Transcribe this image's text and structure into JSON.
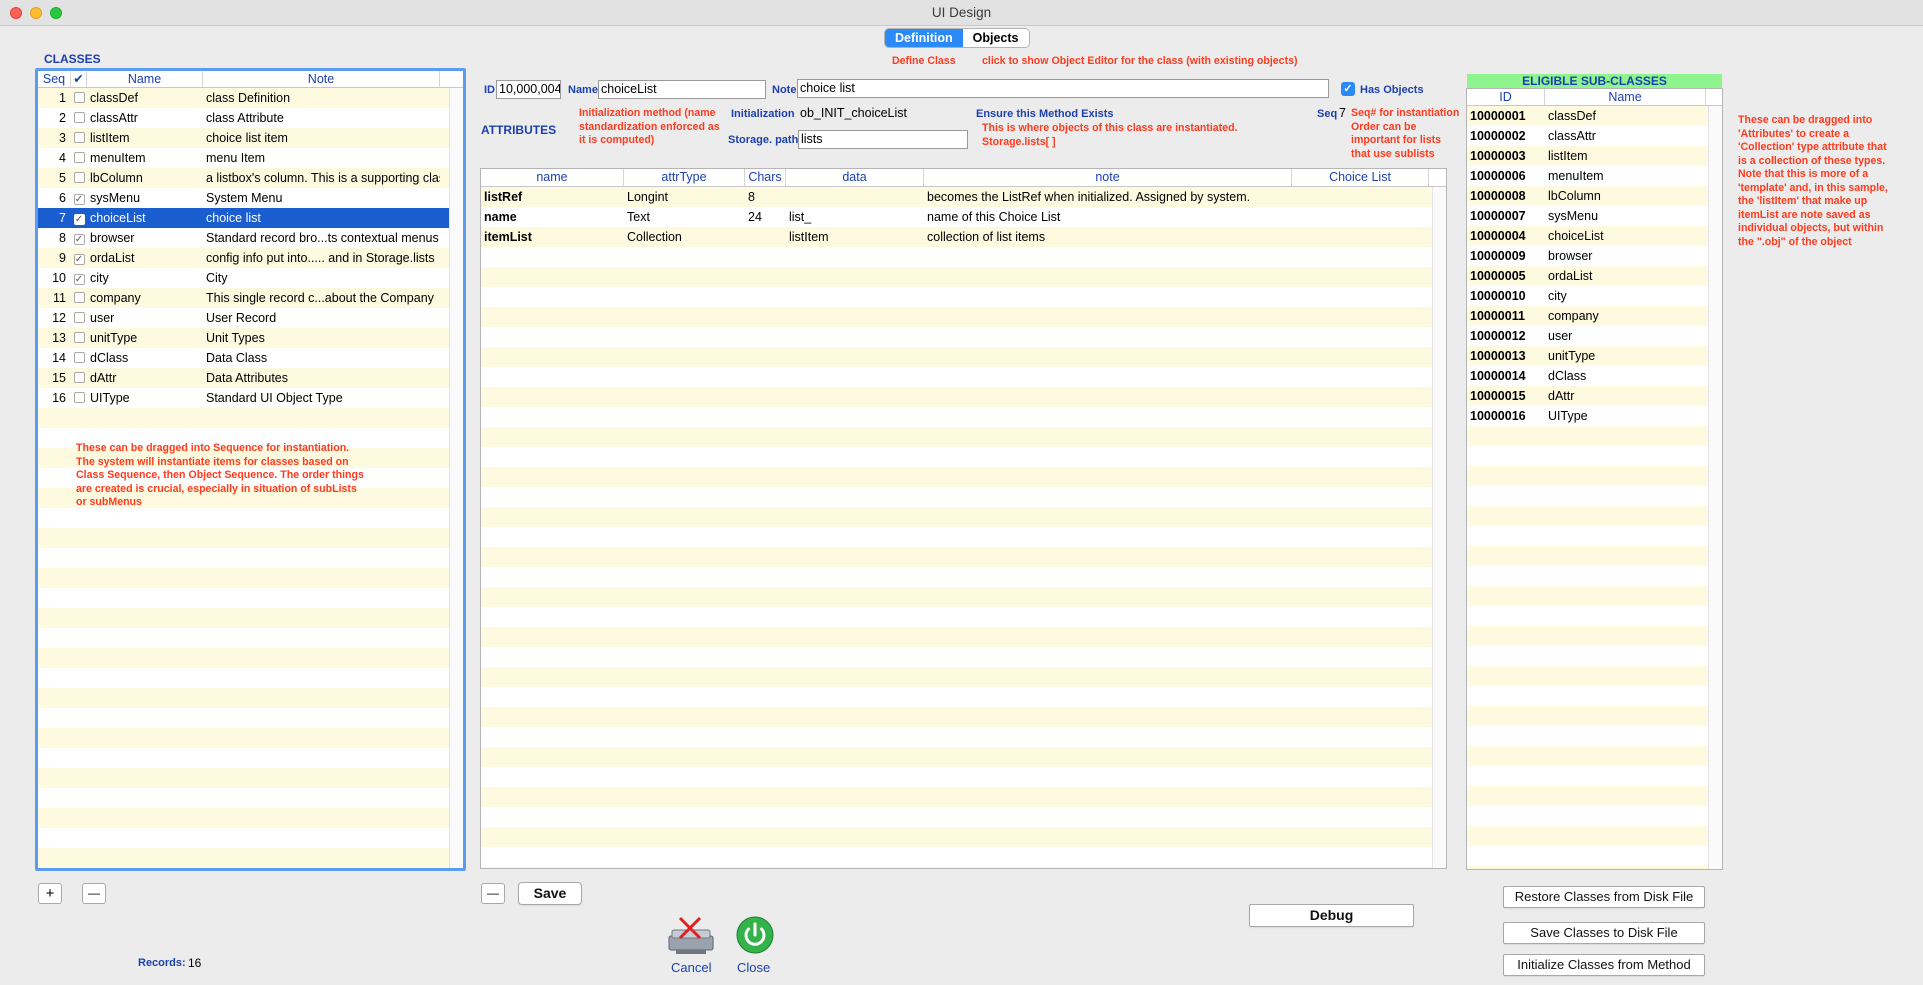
{
  "window": {
    "title": "UI Design"
  },
  "tabs": [
    {
      "label": "Definition"
    },
    {
      "label": "Objects"
    }
  ],
  "hints": {
    "define_class": "Define Class",
    "objects_hint": "click to show Object Editor for the class (with existing objects)",
    "init_hint": "Initialization method (name standardization enforced as it is computed)",
    "ensure_method": "Ensure this Method Exists",
    "instantiated_here": "This is where objects of this class are instantiated.",
    "storage_lists": "Storage.lists[ ]",
    "seq_hint": "Seq# for instantiation Order can be important for lists that use sublists",
    "drag_sequence": "These can be dragged into Sequence for instantiation. The system will instantiate items for classes based on Class Sequence, then Object Sequence. The order things are created is crucial, especially in situation of subLists or subMenus",
    "drag_attributes": "These can be dragged into 'Attributes' to create a 'Collection' type attribute that is a collection of these types. Note that this is more of a 'template' and, in this sample, the 'listItem' that make up itemList are note saved as individual objects, but within the \".obj\" of the object"
  },
  "classes": {
    "title": "CLASSES",
    "headers": {
      "seq": "Seq",
      "check": "✔",
      "name": "Name",
      "note": "Note"
    },
    "rows": [
      {
        "seq": "1",
        "checked": false,
        "name": "classDef",
        "note": "class Definition"
      },
      {
        "seq": "2",
        "checked": false,
        "name": "classAttr",
        "note": "class Attribute"
      },
      {
        "seq": "3",
        "checked": false,
        "name": "listItem",
        "note": "choice list item"
      },
      {
        "seq": "4",
        "checked": false,
        "name": "menuItem",
        "note": "menu Item"
      },
      {
        "seq": "5",
        "checked": false,
        "name": "lbColumn",
        "note": "a listbox's column. This is a supporting class"
      },
      {
        "seq": "6",
        "checked": true,
        "name": "sysMenu",
        "note": "System Menu"
      },
      {
        "seq": "7",
        "checked": true,
        "name": "choiceList",
        "note": "choice list",
        "selected": true
      },
      {
        "seq": "8",
        "checked": true,
        "name": "browser",
        "note": "Standard record bro...ts contextual menus"
      },
      {
        "seq": "9",
        "checked": true,
        "name": "ordaList",
        "note": "config info put into..... and in Storage.lists"
      },
      {
        "seq": "10",
        "checked": true,
        "name": "city",
        "note": "City"
      },
      {
        "seq": "11",
        "checked": false,
        "name": "company",
        "note": "This single record c...about the Company"
      },
      {
        "seq": "12",
        "checked": false,
        "name": "user",
        "note": "User Record"
      },
      {
        "seq": "13",
        "checked": false,
        "name": "unitType",
        "note": "Unit Types"
      },
      {
        "seq": "14",
        "checked": false,
        "name": "dClass",
        "note": "Data Class"
      },
      {
        "seq": "15",
        "checked": false,
        "name": "dAttr",
        "note": "Data Attributes"
      },
      {
        "seq": "16",
        "checked": false,
        "name": "UIType",
        "note": "Standard UI Object Type"
      }
    ],
    "add_label": "+",
    "remove_label": "—",
    "records_label": "Records:",
    "records_count": "16"
  },
  "definition": {
    "id_label": "ID",
    "id_value": "10,000,004",
    "name_label": "Name",
    "name_value": "choiceList",
    "note_label": "Note",
    "note_value": "choice list",
    "has_objects_label": "Has Objects",
    "has_objects": true,
    "initialization_label": "Initialization",
    "initialization_value": "ob_INIT_choiceList",
    "storage_label": "Storage. path",
    "storage_value": "lists",
    "seq_label": "Seq",
    "seq_value": "7"
  },
  "attributes": {
    "title": "ATTRIBUTES",
    "headers": {
      "name": "name",
      "attrType": "attrType",
      "chars": "Chars",
      "data": "data",
      "note": "note",
      "choice": "Choice List"
    },
    "rows": [
      {
        "name": "listRef",
        "attrType": "Longint",
        "chars": "8",
        "data": "",
        "note": "becomes the ListRef when initialized. Assigned by system.",
        "choice": ""
      },
      {
        "name": "name",
        "attrType": "Text",
        "chars": "24",
        "data": "list_",
        "note": "name of this Choice List",
        "choice": ""
      },
      {
        "name": "itemList",
        "attrType": "Collection",
        "chars": "",
        "data": "listItem",
        "note": "collection of list items",
        "choice": ""
      }
    ],
    "remove_label": "—",
    "save_label": "Save"
  },
  "subclasses": {
    "title": "ELIGIBLE SUB-CLASSES",
    "headers": {
      "id": "ID",
      "name": "Name"
    },
    "rows": [
      {
        "id": "10000001",
        "name": "classDef"
      },
      {
        "id": "10000002",
        "name": "classAttr"
      },
      {
        "id": "10000003",
        "name": "listItem"
      },
      {
        "id": "10000006",
        "name": "menuItem"
      },
      {
        "id": "10000008",
        "name": "lbColumn"
      },
      {
        "id": "10000007",
        "name": "sysMenu"
      },
      {
        "id": "10000004",
        "name": "choiceList"
      },
      {
        "id": "10000009",
        "name": "browser"
      },
      {
        "id": "10000005",
        "name": "ordaList"
      },
      {
        "id": "10000010",
        "name": "city"
      },
      {
        "id": "10000011",
        "name": "company"
      },
      {
        "id": "10000012",
        "name": "user"
      },
      {
        "id": "10000013",
        "name": "unitType"
      },
      {
        "id": "10000014",
        "name": "dClass"
      },
      {
        "id": "10000015",
        "name": "dAttr"
      },
      {
        "id": "10000016",
        "name": "UIType"
      }
    ]
  },
  "footer": {
    "cancel_label": "Cancel",
    "close_label": "Close",
    "debug_label": "Debug",
    "restore_label": "Restore Classes from Disk File",
    "save_disk_label": "Save Classes to Disk File",
    "init_label": "Initialize Classes from Method"
  },
  "colors": {
    "accent": "#2b8af7",
    "selection": "#1a5dce",
    "label_blue": "#1d40b0",
    "hint_red": "#ff3b1f",
    "stripe": "#fefae0",
    "subclass_header": "#8ef58e"
  }
}
